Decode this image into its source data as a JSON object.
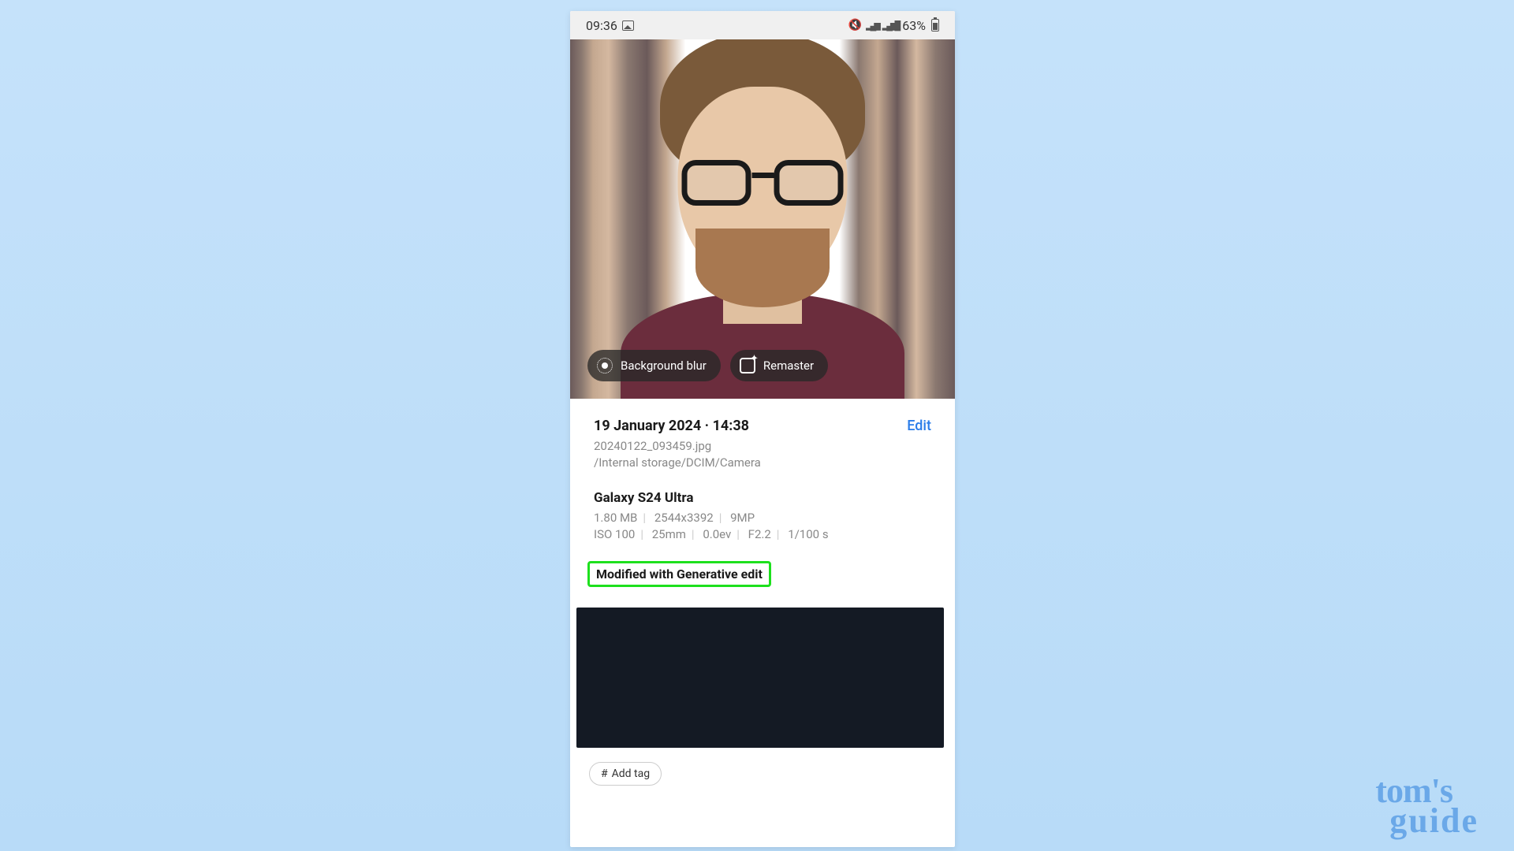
{
  "status_bar": {
    "time": "09:36",
    "battery_pct": "63%"
  },
  "photo": {
    "buttons": {
      "background_blur": "Background blur",
      "remaster": "Remaster"
    }
  },
  "details": {
    "date_time": "19 January 2024 · 14:38",
    "edit_label": "Edit",
    "filename": "20240122_093459.jpg",
    "filepath": "/Internal storage/DCIM/Camera",
    "device": "Galaxy S24 Ultra",
    "file_meta": {
      "size": "1.80 MB",
      "resolution": "2544x3392",
      "megapixels": "9MP"
    },
    "camera_meta": {
      "iso": "ISO 100",
      "focal": "25mm",
      "ev": "0.0ev",
      "aperture": "F2.2",
      "shutter": "1/100 s"
    },
    "generative_label": "Modified with Generative edit",
    "add_tag_label": "Add tag"
  },
  "watermark": {
    "line1": "tom's",
    "line2": "guide"
  },
  "highlight_color": "#1de01d"
}
